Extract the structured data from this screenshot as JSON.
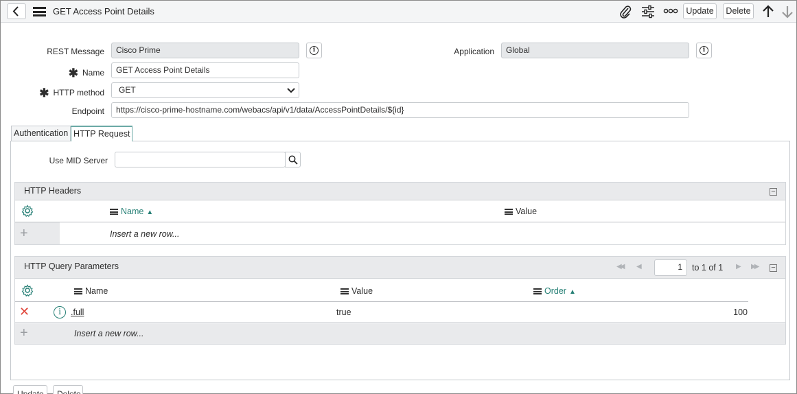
{
  "header": {
    "title": "GET Access Point Details",
    "update_label": "Update",
    "delete_label": "Delete"
  },
  "form": {
    "rest_message": {
      "label": "REST Message",
      "value": "Cisco Prime"
    },
    "application": {
      "label": "Application",
      "value": "Global"
    },
    "name": {
      "label": "Name",
      "value": "GET Access Point Details"
    },
    "http_method": {
      "label": "HTTP method",
      "value": "GET"
    },
    "endpoint": {
      "label": "Endpoint",
      "value": "https://cisco-prime-hostname.com/webacs/api/v1/data/AccessPointDetails/${id}"
    },
    "required_mark": "✱"
  },
  "tabs": [
    {
      "label": "Authentication"
    },
    {
      "label": "HTTP Request"
    }
  ],
  "http_request": {
    "mid_server_label": "Use MID Server",
    "mid_server_value": ""
  },
  "http_headers": {
    "title": "HTTP Headers",
    "columns": [
      {
        "label": "Name",
        "sorted": true
      },
      {
        "label": "Value",
        "sorted": false
      }
    ],
    "insert_row": "Insert a new row..."
  },
  "query_params": {
    "title": "HTTP Query Parameters",
    "page_value": "1",
    "page_of": "to 1 of 1",
    "columns": [
      {
        "label": "Name",
        "sorted": false
      },
      {
        "label": "Value",
        "sorted": false
      },
      {
        "label": "Order",
        "sorted": true
      }
    ],
    "rows": [
      {
        "name": ".full",
        "value": "true",
        "order": "100"
      }
    ],
    "insert_row": "Insert a new row..."
  },
  "footer": {
    "update_label": "Update",
    "delete_label": "Delete"
  },
  "colors": {
    "accent": "#278076",
    "tab_border": "#6aa9a5",
    "delete_x": "#e0453a"
  }
}
